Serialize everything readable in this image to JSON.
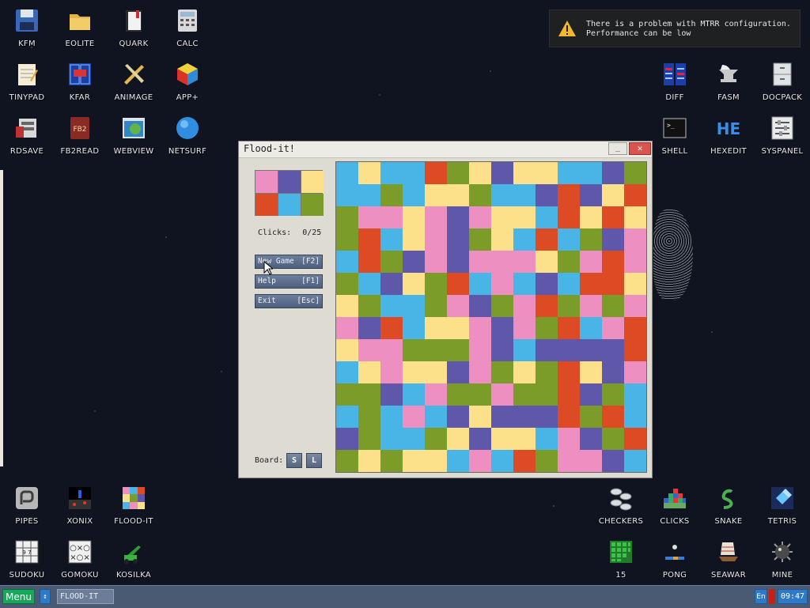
{
  "notification": {
    "line1": "There is a problem with MTRR configuration.",
    "line2": "Performance can be low",
    "icon": "warning-icon"
  },
  "desktop": {
    "kfm": "KFM",
    "eolite": "EOLITE",
    "quark": "QUARK",
    "calc": "CALC",
    "tinypad": "TINYPAD",
    "kfar": "KFAR",
    "animage": "ANIMAGE",
    "appplus": "APP+",
    "rdsave": "RDSAVE",
    "fb2read": "FB2READ",
    "webview": "WEBVIEW",
    "netsurf": "NETSURF",
    "diff": "DIFF",
    "fasm": "FASM",
    "docpack": "DOCPACK",
    "shell": "SHELL",
    "hexedit": "HEXEDIT",
    "syspanel": "SYSPANEL",
    "pipes": "PIPES",
    "xonix": "XONIX",
    "floodit": "FLOOD-IT",
    "sudoku": "SUDOKU",
    "gomoku": "GOMOKU",
    "kosilka": "KOSILKA",
    "checkers": "CHECKERS",
    "clicks": "CLICKS",
    "snake": "SNAKE",
    "tetris": "TETRIS",
    "fifteen": "15",
    "pong": "PONG",
    "seawar": "SEAWAR",
    "mine": "MINE"
  },
  "window": {
    "title": "Flood-it!",
    "minimize": "_",
    "close": "✕",
    "clicks_label": "Clicks:",
    "clicks_value": "0/25",
    "new_game": "New Game",
    "new_game_key": "[F2]",
    "help": "Help",
    "help_key": "[F1]",
    "exit": "Exit",
    "exit_key": "[Esc]",
    "board_label": "Board:",
    "size_small": "S",
    "size_large": "L"
  },
  "game": {
    "palette": [
      "P",
      "B",
      "Y",
      "R",
      "C",
      "G"
    ],
    "colors": {
      "P": "#ee8fc1",
      "B": "#5f58aa",
      "Y": "#fde08a",
      "R": "#dd4b24",
      "C": "#49b4e6",
      "G": "#7c9c2a"
    },
    "clicks_used": 0,
    "clicks_max": 25,
    "grid": [
      "CYCCRGYBYYCCBG",
      "CCGCYYGCCBRBYR",
      "GPPYPBPYYCRYRY",
      "GRCYPBGYCRCGBP",
      "CRGBPBPPPYGPRP",
      "GCBYGRCPCBCRRY",
      "YGCCGPBGPRGPGP",
      "PBRCYYPBPGRCPR",
      "YPPGGGPBCBBBBR",
      "CYPYYBPGYGRYBP",
      "GGBCPGGPGGRBGC",
      "CGCPCBYBBBRGRC",
      "BGCCGYBYYCPBGR",
      "GYGYYCPCRGPPBC"
    ]
  },
  "taskbar": {
    "menu": "Menu",
    "arrow": "↕",
    "task": "FLOOD-IT",
    "lang": "En",
    "clock": "09:47"
  }
}
